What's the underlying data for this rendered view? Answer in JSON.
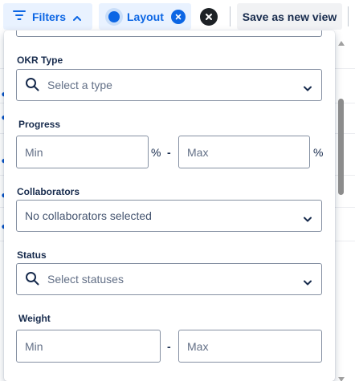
{
  "toolbar": {
    "filters_label": "Filters",
    "layout_label": "Layout",
    "save_label": "Save as new view"
  },
  "filters_panel": {
    "okr_type": {
      "label": "OKR Type",
      "placeholder": "Select a type"
    },
    "progress": {
      "label": "Progress",
      "min_placeholder": "Min",
      "max_placeholder": "Max",
      "unit": "%",
      "separator": "-"
    },
    "collaborators": {
      "label": "Collaborators",
      "value": "No collaborators selected"
    },
    "status": {
      "label": "Status",
      "placeholder": "Select statuses"
    },
    "weight": {
      "label": "Weight",
      "min_placeholder": "Min",
      "max_placeholder": "Max",
      "separator": "-"
    }
  },
  "colors": {
    "accent": "#0c66e4",
    "accent_bg": "#e9f2ff",
    "text": "#172b4d",
    "placeholder": "#626f86",
    "border": "#8590a2"
  },
  "icons": [
    "filter-icon",
    "chevron-up-icon",
    "layout-dot-icon",
    "close-icon",
    "clear-icon",
    "search-icon",
    "chevron-down-icon"
  ]
}
